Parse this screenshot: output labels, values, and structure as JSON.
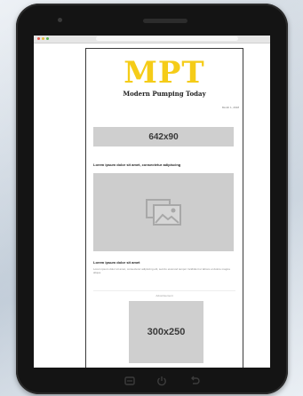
{
  "email": {
    "logo_text": "MPT",
    "tagline": "Modern Pumping Today",
    "date_text": "Month 1, 2018",
    "top_ad_label": "642x90",
    "headline": "Lorem ipsum dolor sit amet, consectetur adipiscing",
    "article_title": "Lorem ipsum dolor sit amet",
    "article_text": "Lorem ipsum dolor sit amet, consectetur adipiscing elit, sed do eiusmod tempor incididunt ut labore et dolore magna aliqua.",
    "advertisement_label": "Advertisement",
    "box_ad_label": "300x250"
  },
  "icons": {
    "image_placeholder": "image-icon",
    "nav_recent": "recent-apps-icon",
    "nav_home": "power-icon",
    "nav_back": "back-icon"
  },
  "colors": {
    "logo": "#f5cc18",
    "tablet_frame": "#141414",
    "ad_gray": "#cfcfcf"
  }
}
